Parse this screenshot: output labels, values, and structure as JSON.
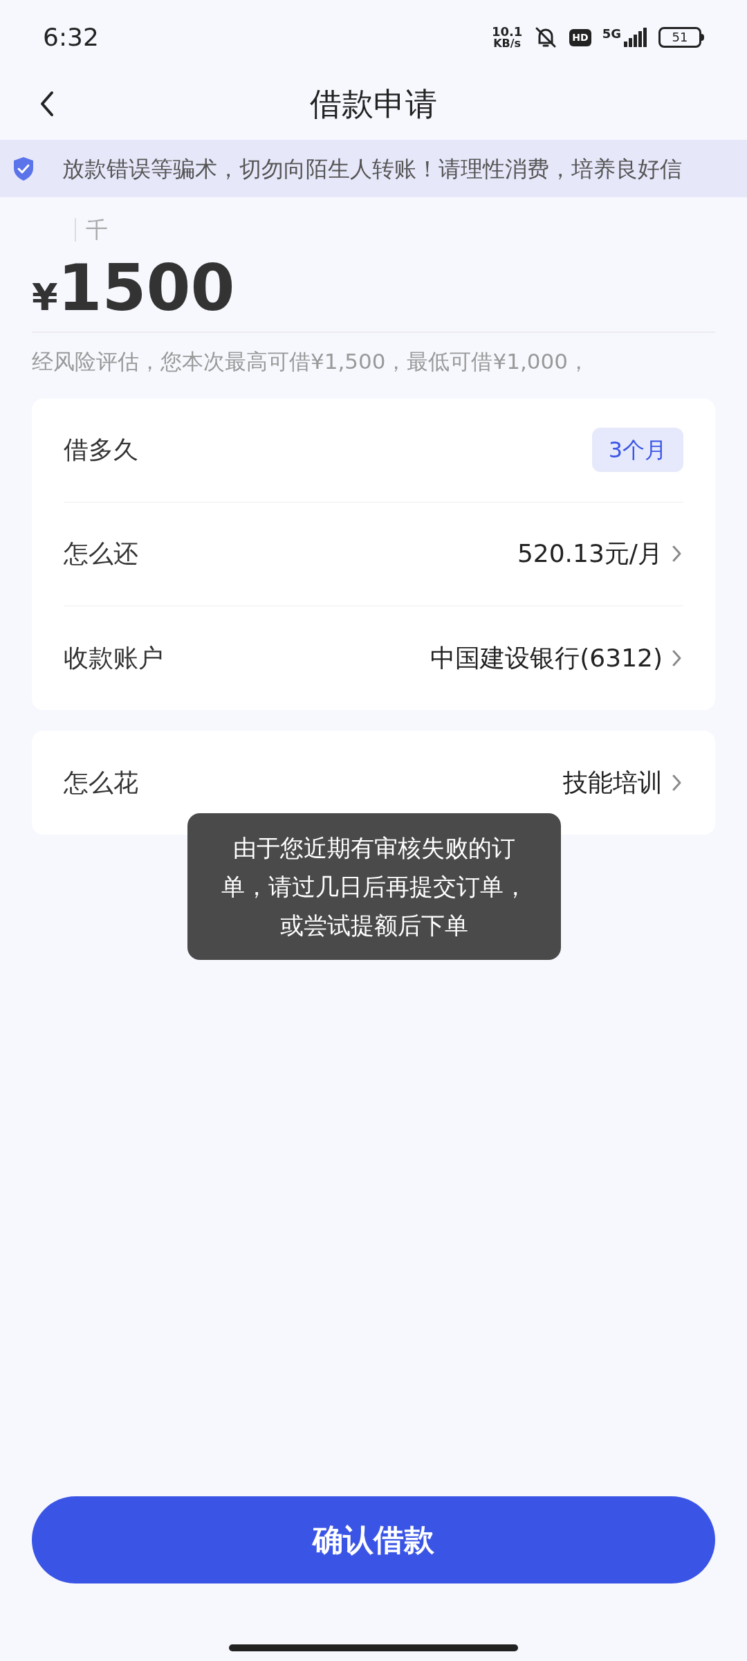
{
  "status_bar": {
    "time": "6:32",
    "net_speed_value": "10.1",
    "net_speed_unit": "KB/s",
    "hd": "HD",
    "network": "5G",
    "battery": "51"
  },
  "header": {
    "title": "借款申请"
  },
  "notice": {
    "text": "放款错误等骗术，切勿向陌生人转账！请理性消费，培养良好信"
  },
  "amount": {
    "unit_hint": "千",
    "currency": "¥",
    "value": "1500",
    "note": "经风险评估，您本次最高可借¥1,500，最低可借¥1,000，"
  },
  "loan_card": [
    {
      "kind": "tag",
      "label": "借多久",
      "value": "3个月"
    },
    {
      "kind": "link",
      "label": "怎么还",
      "value": "520.13元/月"
    },
    {
      "kind": "link",
      "label": "收款账户",
      "value": "中国建设银行(6312)"
    }
  ],
  "purpose_card": [
    {
      "kind": "link",
      "label": "怎么花",
      "value": "技能培训"
    }
  ],
  "toast": {
    "text": "由于您近期有审核失败的订单，请过几日后再提交订单，或尝试提额后下单"
  },
  "confirm_button": {
    "label": "确认借款"
  }
}
